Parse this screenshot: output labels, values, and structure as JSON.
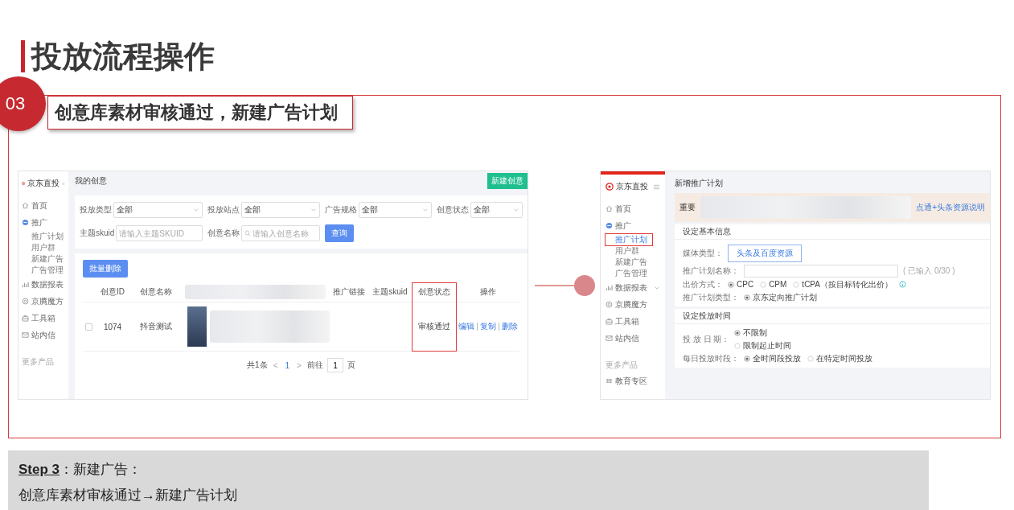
{
  "slide_title": "投放流程操作",
  "step": {
    "number": "03",
    "title": "创意库素材审核通过，新建广告计划"
  },
  "left_screen": {
    "sidebar": {
      "brand": "京东直投",
      "more_label": "更多产品",
      "items": [
        {
          "label": "首页",
          "kind": "link",
          "selected": false
        },
        {
          "label": "推广",
          "kind": "link",
          "selected": false,
          "children": [
            {
              "label": "推广计划",
              "selected": false
            },
            {
              "label": "用户群",
              "selected": false
            },
            {
              "label": "新建广告",
              "selected": false
            },
            {
              "label": "广告管理",
              "selected": false
            }
          ]
        },
        {
          "label": "数据报表",
          "kind": "group",
          "selected": false
        },
        {
          "label": "京腾魔方",
          "kind": "link",
          "selected": false
        },
        {
          "label": "工具箱",
          "kind": "link",
          "selected": false
        },
        {
          "label": "站内信",
          "kind": "link",
          "selected": false
        }
      ]
    },
    "page_title": "我的创意",
    "new_button": "新建创意",
    "filters": [
      {
        "kind": "select",
        "label": "投放类型",
        "value": "全部"
      },
      {
        "kind": "select",
        "label": "投放站点",
        "value": "全部"
      },
      {
        "kind": "select",
        "label": "广告规格",
        "value": "全部"
      },
      {
        "kind": "select",
        "label": "创意状态",
        "value": "全部"
      },
      {
        "kind": "input",
        "label": "主题skuid",
        "placeholder": "请输入主题SKUID"
      },
      {
        "kind": "search",
        "label": "创意名称",
        "placeholder": "请输入创意名称"
      }
    ],
    "query_button": "查询",
    "batch_button": "批量删除",
    "columns": [
      {
        "kind": "id",
        "label": "创意ID",
        "highlighted": false
      },
      {
        "kind": "name",
        "label": "创意名称",
        "highlighted": false
      },
      {
        "kind": "media",
        "highlighted": false
      },
      {
        "kind": "link",
        "label": "推广链接",
        "highlighted": false
      },
      {
        "kind": "sku",
        "label": "主题skuid",
        "highlighted": false
      },
      {
        "kind": "status",
        "label": "创意状态",
        "highlighted": true
      },
      {
        "kind": "actions",
        "label": "操作",
        "highlighted": false
      }
    ],
    "rows": [
      {
        "checked": false,
        "id": "1074",
        "name": "抖音测试",
        "status": "审核通过",
        "actions": [
          "编辑",
          "复制",
          "删除"
        ]
      }
    ],
    "pagination": {
      "total": "共1条",
      "prev": "<",
      "current": "1",
      "next": ">",
      "goto_label": "前往",
      "goto_value": "1",
      "unit": "页"
    }
  },
  "right_screen": {
    "sidebar": {
      "brand": "京东直投",
      "more_label": "更多产品",
      "items": [
        {
          "label": "首页",
          "kind": "link",
          "selected": false
        },
        {
          "label": "推广",
          "kind": "link",
          "selected": false,
          "children": [
            {
              "label": "推广计划",
              "selected": true
            },
            {
              "label": "用户群",
              "selected": false
            },
            {
              "label": "新建广告",
              "selected": false
            },
            {
              "label": "广告管理",
              "selected": false
            }
          ]
        },
        {
          "label": "数据报表",
          "kind": "group",
          "selected": false
        },
        {
          "label": "京腾魔方",
          "kind": "link",
          "selected": false
        },
        {
          "label": "工具箱",
          "kind": "link",
          "selected": false
        },
        {
          "label": "站内信",
          "kind": "link",
          "selected": false
        }
      ],
      "more_items": [
        {
          "label": "教育专区",
          "selected": false
        }
      ]
    },
    "page_title": "新增推广计划",
    "notice": {
      "title": "重要",
      "link": "点通+头条资源说明"
    },
    "sections": [
      {
        "title": "设定基本信息",
        "fields": [
          {
            "kind": "buttons",
            "label": "媒体类型：",
            "options": [
              {
                "label": "头条及百度资源",
                "selected": true
              }
            ]
          },
          {
            "kind": "input",
            "label": "推广计划名称：",
            "counter": "( 已输入 0/30 )"
          },
          {
            "kind": "radio",
            "label": "出价方式：",
            "help": true,
            "options": [
              {
                "label": "CPC",
                "selected": true
              },
              {
                "label": "CPM",
                "selected": false
              },
              {
                "label": "tCPA（按目标转化出价）",
                "selected": false
              }
            ]
          },
          {
            "kind": "radio",
            "label": "推广计划类型：",
            "help": false,
            "options": [
              {
                "label": "京东定向推广计划",
                "selected": true
              }
            ]
          }
        ]
      },
      {
        "title": "设定投放时间",
        "fields": [
          {
            "kind": "radio_stack",
            "label": "投 放 日 期：",
            "options": [
              {
                "label": "不限制",
                "selected": true
              },
              {
                "label": "限制起止时间",
                "selected": false
              }
            ]
          },
          {
            "kind": "radio",
            "label": "每日投放时段：",
            "help": false,
            "options": [
              {
                "label": "全时间段投放",
                "selected": true
              },
              {
                "label": "在特定时间投放",
                "selected": false
              }
            ]
          }
        ]
      }
    ]
  },
  "note": {
    "heading": "**Step 3**：新建广告：",
    "line": "创意库素材审核通过→新建广告计划"
  }
}
